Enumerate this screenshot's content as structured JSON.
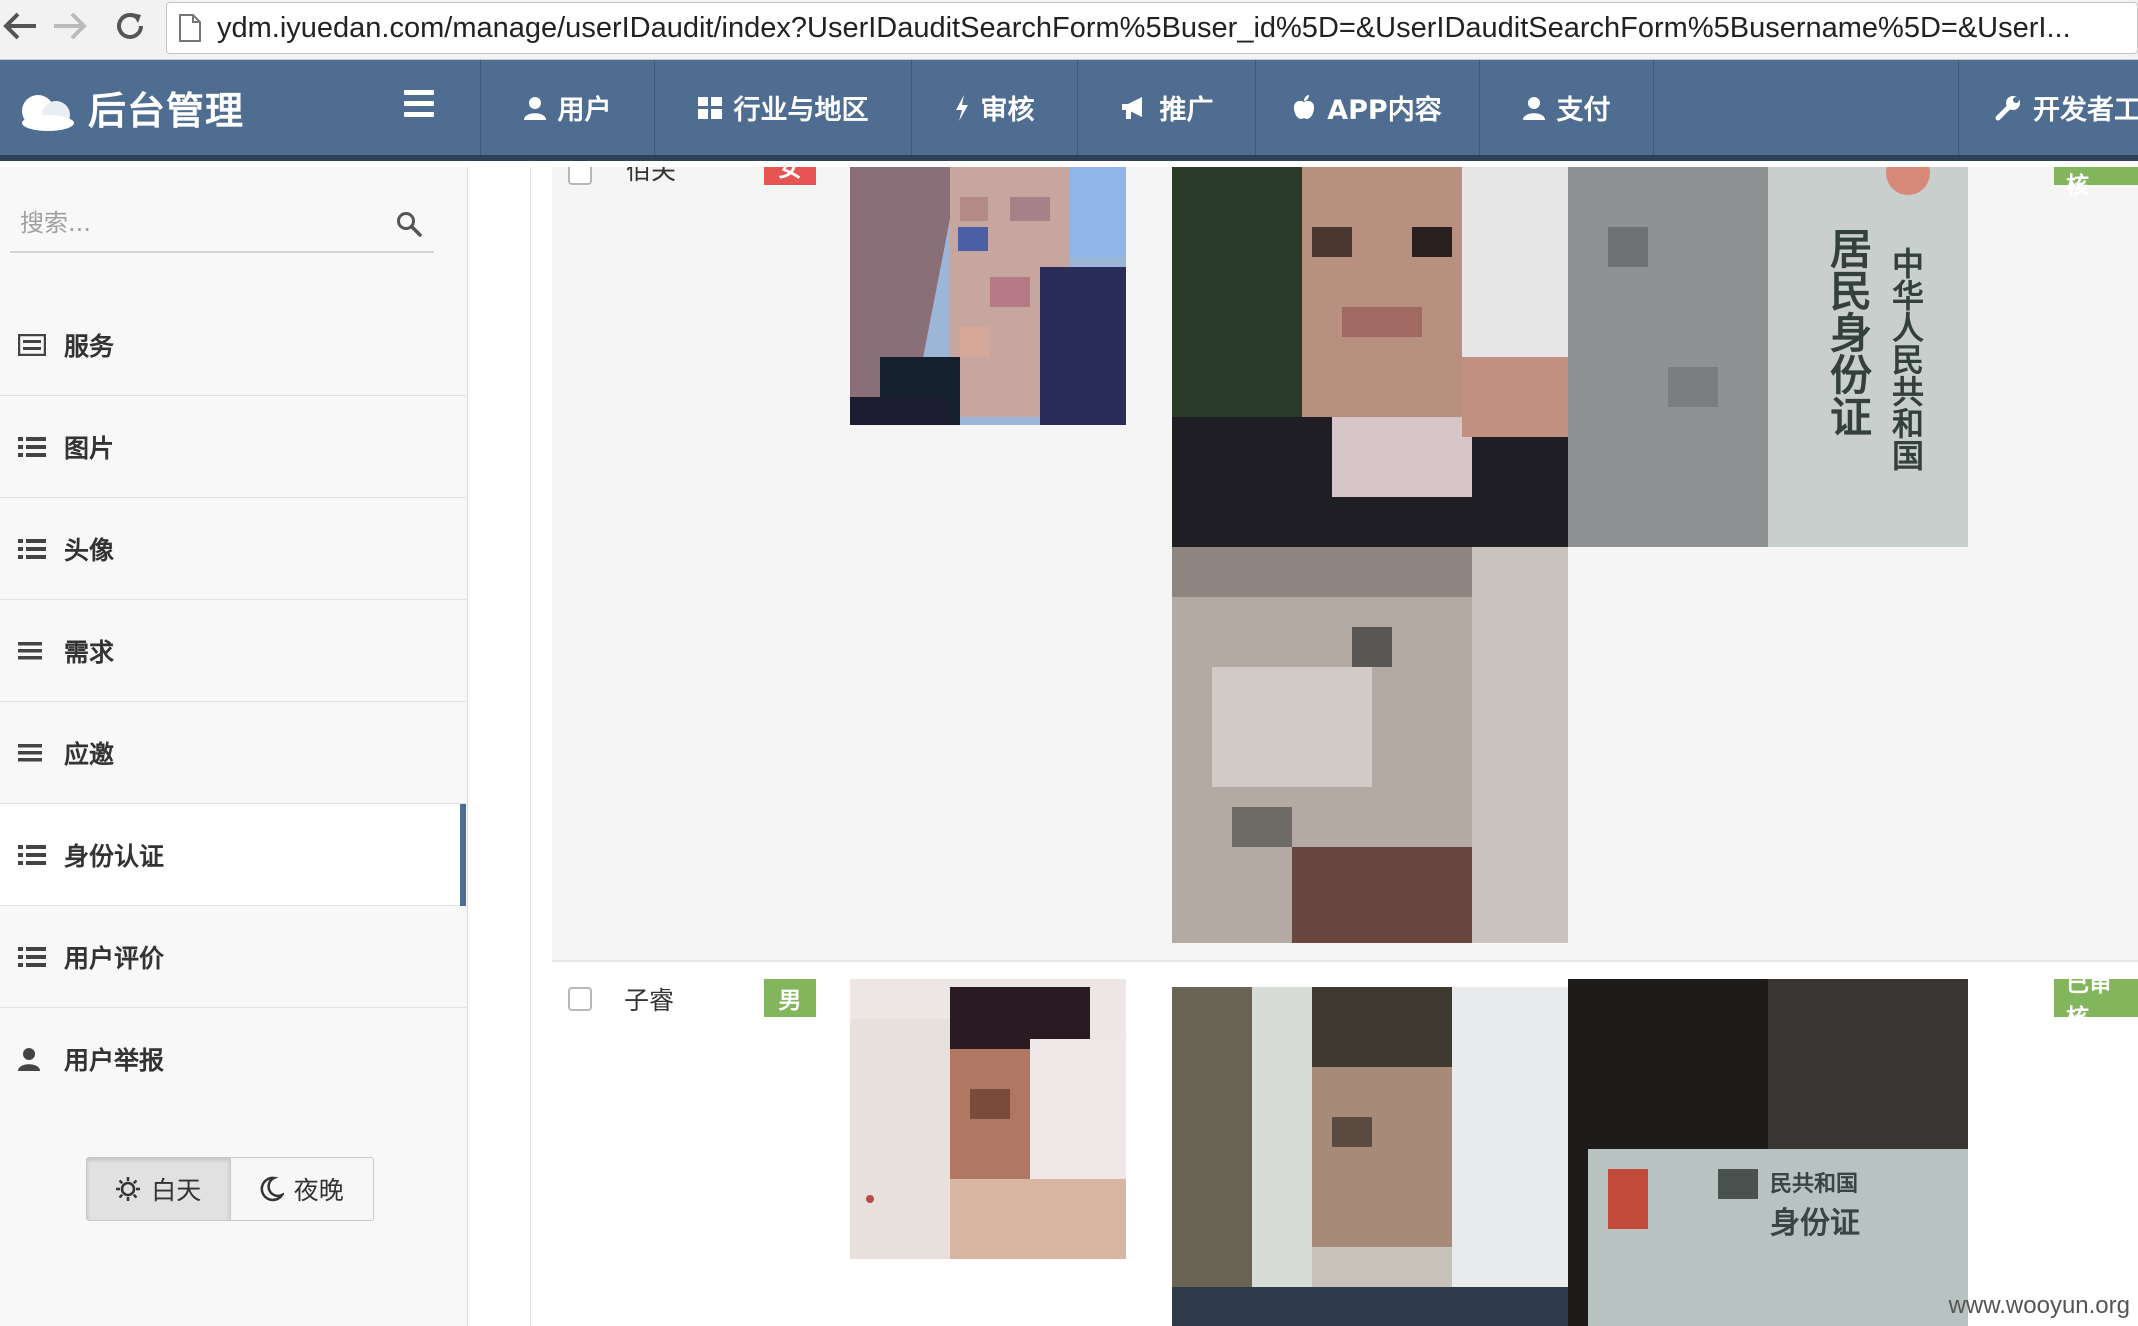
{
  "browser": {
    "url": "ydm.iyuedan.com/manage/userIDaudit/index?UserIDauditSearchForm%5Buser_id%5D=&UserIDauditSearchForm%5Busername%5D=&UserI..."
  },
  "app": {
    "title": "后台管理"
  },
  "topnav": {
    "items": [
      {
        "label": "用户",
        "icon": "user-icon"
      },
      {
        "label": "行业与地区",
        "icon": "grid-icon"
      },
      {
        "label": "审核",
        "icon": "bolt-icon"
      },
      {
        "label": "推广",
        "icon": "bullhorn-icon"
      },
      {
        "label": "APP内容",
        "icon": "apple-icon"
      },
      {
        "label": "支付",
        "icon": "user-icon"
      },
      {
        "label": "开发者工",
        "icon": "wrench-icon"
      }
    ]
  },
  "sidebar": {
    "search_placeholder": "搜索...",
    "items": [
      {
        "label": "服务",
        "icon": "list-alt-icon"
      },
      {
        "label": "图片",
        "icon": "list-icon"
      },
      {
        "label": "头像",
        "icon": "list-icon"
      },
      {
        "label": "需求",
        "icon": "bars-icon"
      },
      {
        "label": "应邀",
        "icon": "bars-icon"
      },
      {
        "label": "身份认证",
        "icon": "list-icon",
        "active": true
      },
      {
        "label": "用户评价",
        "icon": "list-icon"
      },
      {
        "label": "用户举报",
        "icon": "user-icon"
      }
    ],
    "theme": {
      "day": "白天",
      "night": "夜晚",
      "selected": "白天"
    }
  },
  "records": [
    {
      "name": "佰关",
      "gender": "女",
      "status": "已审核",
      "colors": {
        "gender": "#e65454"
      }
    },
    {
      "name": "子睿",
      "gender": "男",
      "status": "已审核",
      "colors": {
        "gender": "#82b55c"
      }
    }
  ],
  "id_card_text": {
    "country": "中华人民共和国",
    "card_title": "居民身份证",
    "card_title_2": "身份证",
    "country_partial": "民共和国"
  },
  "watermark": "www.wooyun.org"
}
